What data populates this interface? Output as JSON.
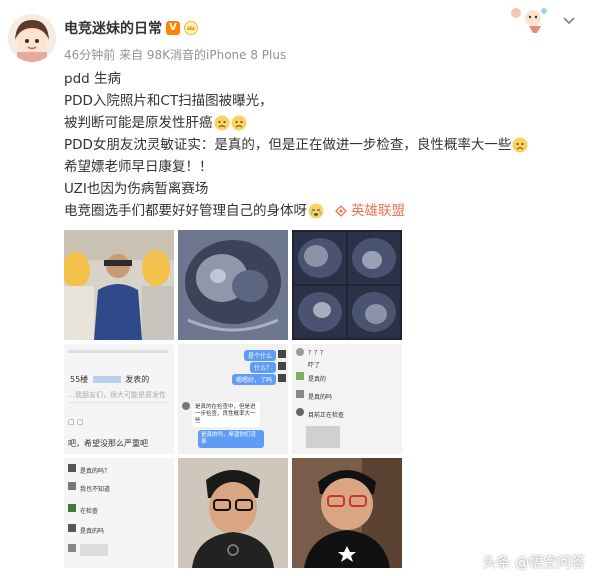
{
  "post": {
    "username": "电竞迷妹的日常",
    "verified_badge": "V",
    "meta": "46分钟前 来自 98K消音的iPhone 8 Plus",
    "lines": [
      "pdd 生病",
      "PDD入院照片和CT扫描图被曝光，",
      "被判断可能是原发性肝癌",
      "PDD女朋友沈灵敏证实：是真的，但是正在做进一步检查，良性概率大一些",
      "希望嫖老师早日康复！！",
      "UZI也因为伤病暂离赛场",
      "电竞圈选手们都要好好管理自己的身体呀"
    ],
    "topic_link": "英雄联盟"
  },
  "images": {
    "chat1": {
      "row1": "55楼",
      "row1b": "发表的",
      "row2": "…我朋友们，很大可能是原发性",
      "row3": "吧，希望没那么严重吧"
    },
    "chat2": {
      "b1": "是个什么",
      "b2": "什么？",
      "b3": "嗯嗯好，了吗",
      "g1": "是真的在检查中，但是进一步检查，良性概率大一些",
      "b4": "是真的吗，希望你们没事"
    },
    "chat3": {
      "m1": "？？？",
      "m2": "吓了",
      "m3": "是真的",
      "m4": "是真的吗",
      "m5": "目前正在检查"
    },
    "chat4": {
      "m1": "是真的吗？",
      "m2": "我也不知道",
      "m3": "在检查",
      "m4": "是真的吗"
    }
  },
  "watermark": "头条 @悟空问答",
  "colors": {
    "accent": "#ff8200",
    "link": "#eb7350",
    "meta": "#939393"
  }
}
